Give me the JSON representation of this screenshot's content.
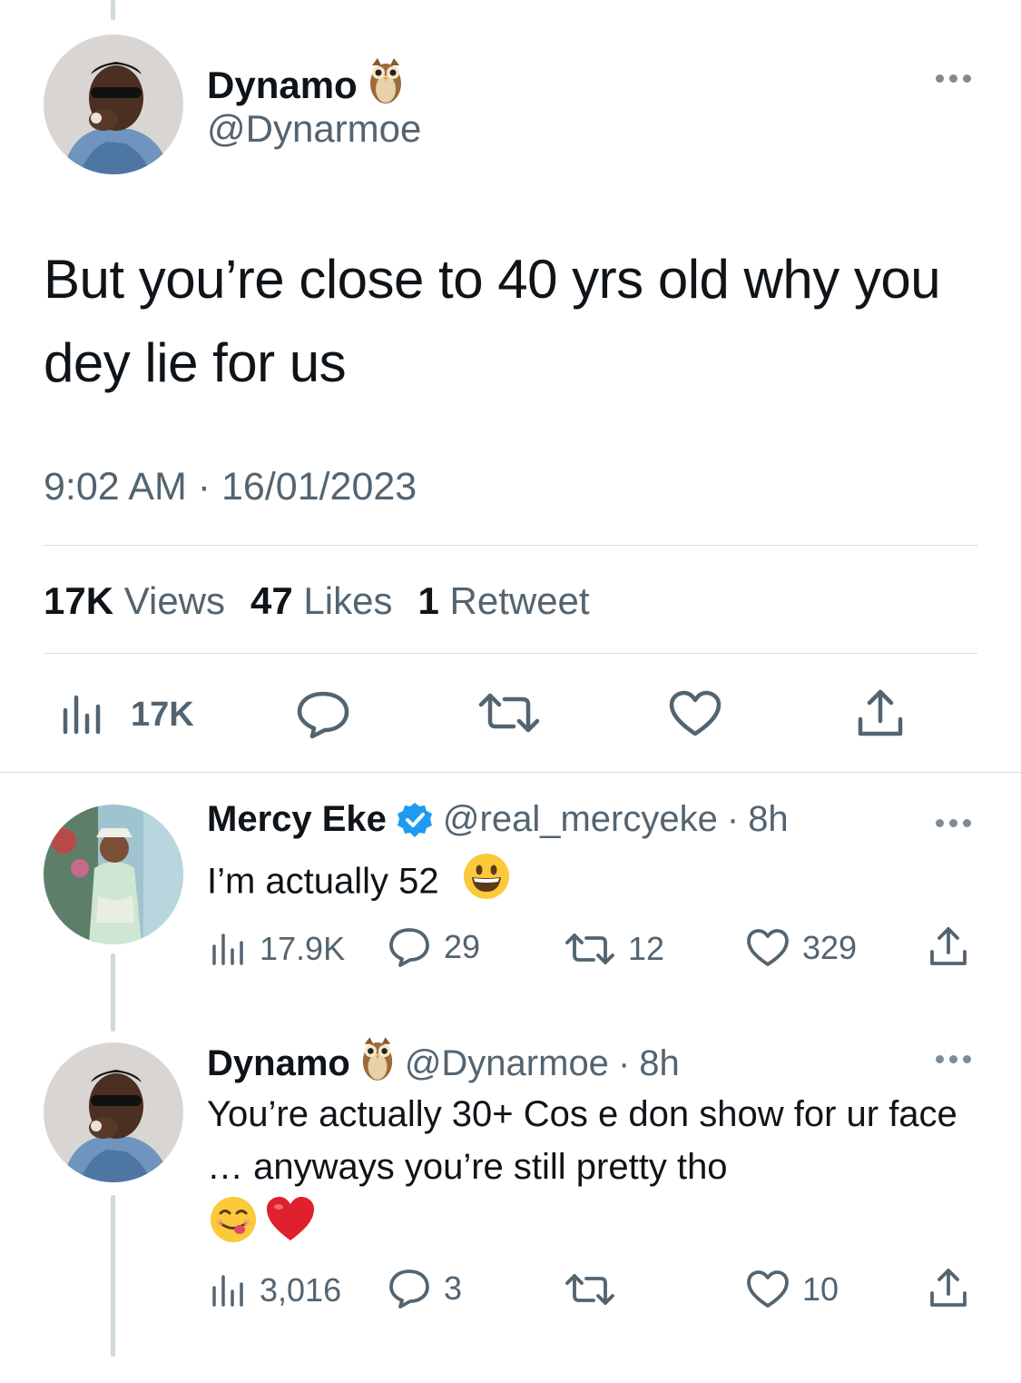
{
  "main_tweet": {
    "author_name": "Dynamo",
    "name_emoji": "owl-emoji",
    "handle": "@Dynarmoe",
    "text": "But you’re close to 40 yrs old why you dey lie for us",
    "time": "9:02 AM",
    "date": "16/01/2023",
    "stats": {
      "views_count": "17K",
      "views_label": "Views",
      "likes_count": "47",
      "likes_label": "Likes",
      "retweets_count": "1",
      "retweets_label": "Retweet"
    },
    "actions": {
      "views": "17K"
    }
  },
  "replies": [
    {
      "author_name": "Mercy Eke",
      "verified": true,
      "handle": "@real_mercyeke",
      "age": "8h",
      "text": "I’m actually 52",
      "emojis": [
        "grinning-face-emoji"
      ],
      "views": "17.9K",
      "replies": "29",
      "retweets": "12",
      "likes": "329"
    },
    {
      "author_name": "Dynamo",
      "name_emoji": "owl-emoji",
      "handle": "@Dynarmoe",
      "age": "8h",
      "text": "You’re actually 30+ Cos e don show for ur face … anyways you’re still pretty tho",
      "emojis": [
        "face-savoring-food-emoji",
        "red-heart-emoji"
      ],
      "views": "3,016",
      "replies": "3",
      "retweets": "",
      "likes": "10"
    }
  ],
  "colors": {
    "text": "#0f1419",
    "muted": "#536471",
    "divider": "#d5dde2",
    "thread_line": "#cfd9de",
    "verified_blue": "#1d9bf0"
  }
}
